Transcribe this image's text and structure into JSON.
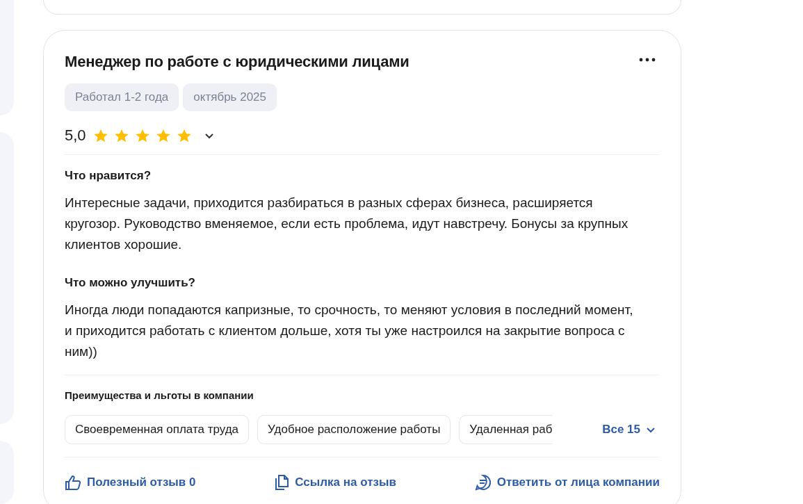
{
  "review": {
    "title": "Менеджер по работе с юридическими лицами",
    "tags": [
      "Работал 1-2 года",
      "октябрь 2025"
    ],
    "rating": "5,0",
    "stars": 5,
    "sections": [
      {
        "heading": "Что нравится?",
        "text": "Интересные задачи, приходится разбираться в разных сферах бизнеса, расширяется кругозор. Руководство вменяемое, если есть проблема, идут навстречу. Бонусы за крупных клиентов хорошие."
      },
      {
        "heading": "Что можно улучшить?",
        "text": "Иногда люди попадаются капризные, то срочность, то меняют условия в последний момент, и приходится работать с клиентом дольше, хотя ты уже настроился на закрытие вопроса с ним))"
      }
    ],
    "benefits": {
      "heading": "Преимущества и льготы в компании",
      "chips": [
        "Своевременная оплата труда",
        "Удобное расположение работы",
        "Удаленная раб"
      ],
      "all_link": "Все 15"
    },
    "actions": [
      {
        "kind": "like",
        "label": "Полезный отзыв 0"
      },
      {
        "kind": "link",
        "label": "Ссылка на отзыв"
      },
      {
        "kind": "reply",
        "label": "Ответить от лица компании"
      }
    ]
  }
}
